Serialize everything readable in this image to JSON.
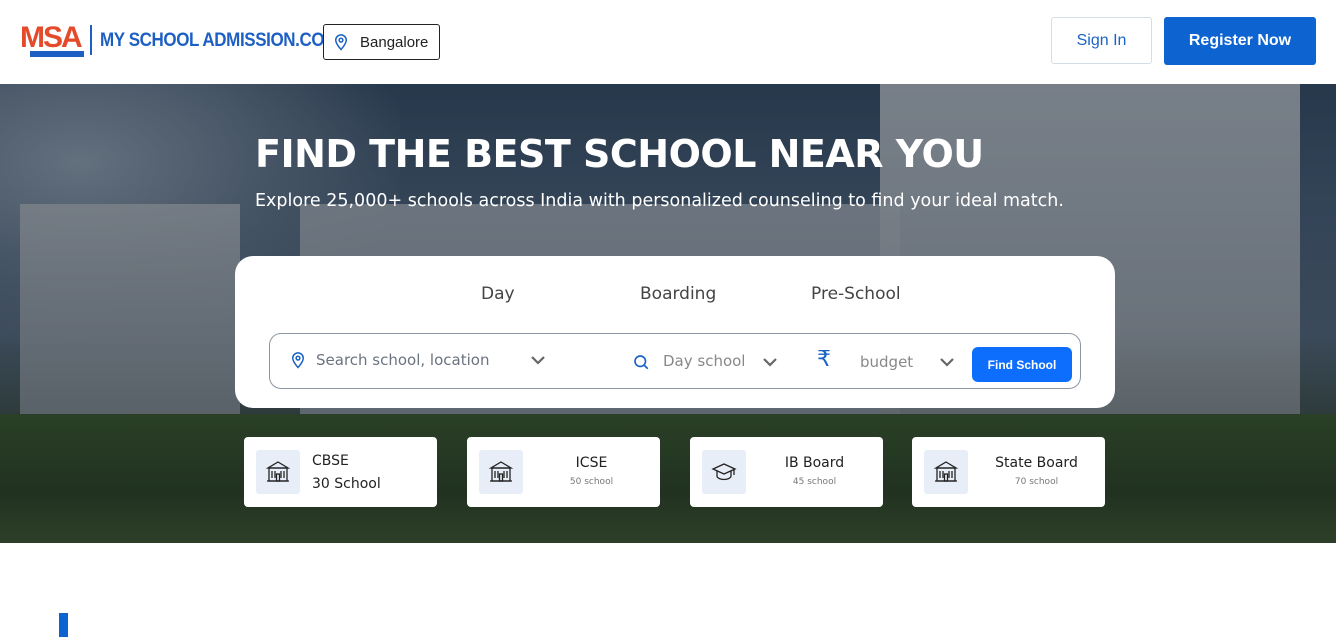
{
  "brand": {
    "logo_mark": "MSA",
    "name": "MY SCHOOL ADMISSION.COM",
    "accent": "#1e5fc4",
    "secondary": "#e34b2a"
  },
  "header": {
    "city": "Bangalore",
    "city_icon": "map-pin-icon",
    "sign_in": "Sign In",
    "register": "Register Now",
    "register_color": "#0d63d0"
  },
  "hero": {
    "title": "FIND THE BEST SCHOOL NEAR YOU",
    "subtitle": "Explore 25,000+ schools across India with personalized counseling to find your ideal match."
  },
  "search": {
    "tabs": [
      "Day",
      "Boarding",
      "Pre-School"
    ],
    "location_placeholder": "Search school, location",
    "school_type": "Day school",
    "currency_symbol": "₹",
    "budget": "budget",
    "button": "Find School",
    "button_color": "#0d6efd"
  },
  "boards": [
    {
      "name": "CBSE",
      "count": "30 School",
      "icon": "school-building-icon"
    },
    {
      "name": "ICSE",
      "count": "50 school",
      "icon": "school-building-icon"
    },
    {
      "name": "IB Board",
      "count": "45 school",
      "icon": "graduation-cap-icon"
    },
    {
      "name": "State Board",
      "count": "70 school",
      "icon": "school-building-icon"
    }
  ]
}
